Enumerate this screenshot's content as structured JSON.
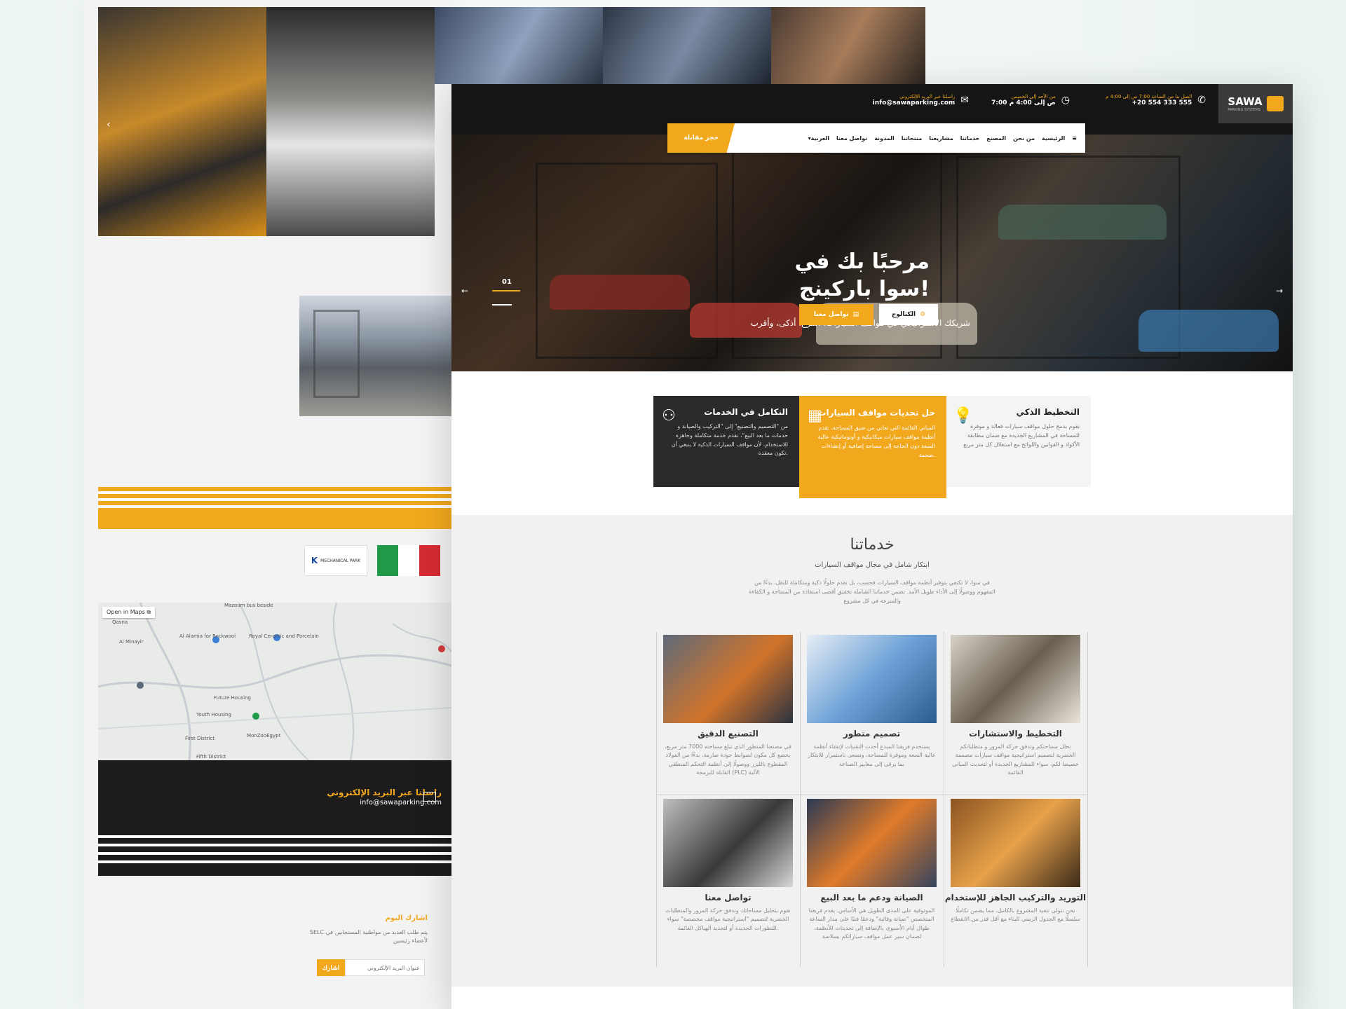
{
  "back": {
    "map_open_label": "Open in Maps",
    "map_labels": [
      "Mazoum bus beside",
      "Al Alamia for Rockwool",
      "Royal Ceramic and Porcelain",
      "Al Minayir",
      "Qasna",
      "Youth Housing",
      "Future Housing",
      "MonZooEgypt",
      "First District",
      "Fifth District"
    ],
    "footer_email_title": "راسلنا عبر البريد الإلكتروني",
    "footer_email_value": "info@sawaparking.com",
    "newsletter_title": "اشارك اليوم",
    "newsletter_desc": "SELC يتم طلب العديد من مواطنية المستجابين في لأعضاء رئيسين",
    "newsletter_placeholder": "عنوان البريد الإلكتروني",
    "newsletter_button": "اشارك",
    "partner_logo_text": "MECHANICAL PARK"
  },
  "topbar": {
    "brand_name": "SAWA",
    "brand_sub": "PARKING SYSTEMS",
    "hours_label": "الصل بنا من الساعة 7:00 ص إلى 4:00 م",
    "phone": "+20 554 333 555",
    "days_label": "من الأحد إلى الخميس",
    "time_value": "7:00 ص إلى 4:00 م",
    "email_label": "راسلنا عبر البريد الإلكتروني",
    "email_value": "info@sawaparking.com"
  },
  "nav": {
    "cta": "حجز مقابلة",
    "links": [
      "الرئيسية",
      "من نحن",
      "المصنع",
      "خدماتنا",
      "مشاريعنا",
      "منتجاتنا",
      "المدونة",
      "تواصل معنا",
      "العربية"
    ]
  },
  "hero": {
    "title_line1": "مرحبًا بك في",
    "title_line2": "سوا باركينج!",
    "subtitle": "شريكك الاستراتيجي في مواقف السيارات: أسرع، أذكى، وأقرب",
    "btn_catalog": "الكتالوج",
    "btn_contact": "تواصل معنا",
    "slide_number": "01"
  },
  "features": [
    {
      "title": "التخطيط الذكي",
      "text": "نقوم بدمج حلول مواقف سيارات فعالة و موفرة للمساحة في المشاريع الجديدة مع ضمان مطابقة الأكواد و القوانين واللوائح مع استغلال كل متر مربع"
    },
    {
      "title": "حل تحديات مواقف السيارات",
      "text": "المباني القائمة التي تعاني من ضيق المساحة، نقدم أنظمة مواقف سيارات ميكانيكية و أوتوماتيكية عالية السعة دون الحاجة إلى مساحة إضافية أو إنشاءات ضخمة."
    },
    {
      "title": "التكامل في الخدمات",
      "text": "من \"التصميم والتصنيع\" إلى \"التركيب والصيانة و خدمات ما بعد البيع\"، نقدم خدمة متكاملة وجاهزة للاستخدام، لأن مواقف السيارات الذكية لا ينبغي أن تكون معقدة."
    }
  ],
  "services": {
    "title": "خدماتنا",
    "subtitle": "ابتكار شامل في مجال مواقف السيارات",
    "description": "في سوا، لا نكتفي بتوفير أنظمة مواقف السيارات فحسب، بل نقدم حلولًا ذكية ومتكاملة للنقل، بدءًا من المفهوم ووصولًا إلى الأداء طويل الأمد. تضمن خدماتنا الشاملة تحقيق أقصى استفادة من المساحة و الكفاءة والسرعة في كل مشروع",
    "items": [
      {
        "title": "التخطيط والاستشارات",
        "text": "نحلل مساحتكم وتدفق حركة المرور و متطلباتكم الخضرية لتصميم استراتيجية مواقف سيارات مصممة خصيصا لكم، سواء للمشاريع الجديدة أو لتحديث المباني القائمة"
      },
      {
        "title": "تصميم متطور",
        "text": "يستخدم فريقنا المبدع أحدث التقنيات لإنشاء أنظمة عالية السعة وموفرة للمساحة، ونسعى باستمرار للابتكار بما يرقى إلى معايير الصناعة"
      },
      {
        "title": "التصنيع الدقيق",
        "text": "في مصنعنا المتطور الذي تبلغ مساحته 7000 متر مربع، يخضع كل مكون لضوابط جودة صارمة، بدءًا من الفولاذ المقطوع بالليزر ووصولًا إلى أنظمة التحكم المنطقي القابلة للبرمجة (PLC) الآلية"
      },
      {
        "title": "التوريد والتركيب الجاهز للإستخدام",
        "text": "نحن نتولى تنفيذ المشروع بالكامل، مما يضمن تكاملًا سلسلًا مع الجدول الزمني للبناء مع أقل قدر من الانقطاع"
      },
      {
        "title": "الصيانة ودعم ما بعد البيع",
        "text": "الموثوقية على المدى الطويل هي الأساس. يقدم فريقنا المتخصص \"صيانة وقائية\" ودعمًا فنيًا على مدار الساعة طوال أيام الأسبوع، بالإضافة إلى تحديثات للأنظمة، لضمان سير عمل مواقف سياراتكم بسلاسة"
      },
      {
        "title": "تواصل معنا",
        "text": "نقوم بتحليل مساحاتك وتدفق حركة المرور والمتطلبات الخضرية لتصميم \"استراتيجية مواقف مخصصة\" سواء للتطورات الجديدة أو لتجديد الهياكل القائمة."
      }
    ]
  },
  "colors": {
    "accent": "#f2a81d",
    "dark": "#151515"
  }
}
